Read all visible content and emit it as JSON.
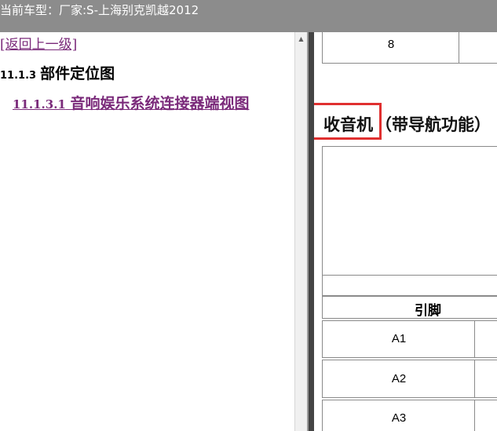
{
  "window": {
    "title": "当前车型：厂家:S-上海别克凯越2012"
  },
  "nav": {
    "back_link": "[返回上一级]",
    "section_number": "11.1.3",
    "section_title": "部件定位图",
    "subsection_number": "11.1.3.1",
    "subsection_title": "音响娱乐系统连接器端视图"
  },
  "content": {
    "prev_row_pin": "8",
    "heading_main": "收音机",
    "heading_suffix": "（带导航功能）",
    "table_header_pin": "引脚",
    "pins": [
      "A1",
      "A2",
      "A3"
    ]
  }
}
